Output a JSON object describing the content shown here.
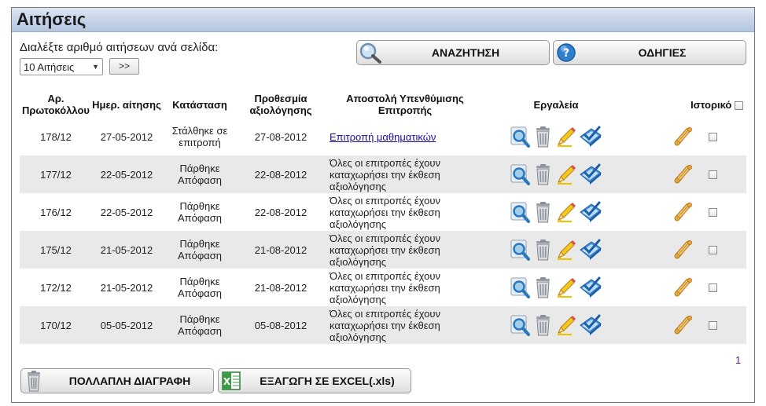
{
  "title": "Αιτήσεις",
  "perpage": {
    "label": "Διαλέξτε αριθμό αιτήσεων ανά σελίδα:",
    "selected": "10 Αιτήσεις",
    "go_label": ">>"
  },
  "buttons": {
    "search": "ΑΝΑΖΗΤΗΣΗ",
    "help": "ΟΔΗΓΙΕΣ",
    "multi_delete": "ΠΟΛΛΑΠΛΗ ΔΙΑΓΡΑΦΗ",
    "export_excel": "ΕΞΑΓΩΓΗ ΣΕ EXCEL(.xls)"
  },
  "table": {
    "headers": {
      "protocol": "Αρ. Πρωτοκόλλου",
      "date": "Ημερ. αίτησης",
      "status": "Κατάσταση",
      "deadline": "Προθεσμία αξιολόγησης",
      "reminder": "Αποστολή Υπενθύμισης Επιτροπής",
      "tools": "Εργαλεία",
      "history": "Ιστορικό"
    },
    "rows": [
      {
        "protocol": "178/12",
        "date": "27-05-2012",
        "status": "Στάλθηκε σε επιτροπή",
        "deadline": "27-08-2012",
        "reminder": "Επιτροπή μαθηματικών",
        "reminder_is_link": true
      },
      {
        "protocol": "177/12",
        "date": "22-05-2012",
        "status": "Πάρθηκε Απόφαση",
        "deadline": "22-08-2012",
        "reminder": "Όλες οι επιτροπές έχουν καταχωρήσει την έκθεση αξιολόγησης",
        "reminder_is_link": false
      },
      {
        "protocol": "176/12",
        "date": "22-05-2012",
        "status": "Πάρθηκε Απόφαση",
        "deadline": "22-08-2012",
        "reminder": "Όλες οι επιτροπές έχουν καταχωρήσει την έκθεση αξιολόγησης",
        "reminder_is_link": false
      },
      {
        "protocol": "175/12",
        "date": "21-05-2012",
        "status": "Πάρθηκε Απόφαση",
        "deadline": "21-08-2012",
        "reminder": "Όλες οι επιτροπές έχουν καταχωρήσει την έκθεση αξιολόγησης",
        "reminder_is_link": false
      },
      {
        "protocol": "172/12",
        "date": "21-05-2012",
        "status": "Πάρθηκε Απόφαση",
        "deadline": "21-08-2012",
        "reminder": "Όλες οι επιτροπές έχουν καταχωρήσει την έκθεση αξιολόγησης",
        "reminder_is_link": false
      },
      {
        "protocol": "170/12",
        "date": "05-05-2012",
        "status": "Πάρθηκε Απόφαση",
        "deadline": "05-08-2012",
        "reminder": "Όλες οι επιτροπές έχουν καταχωρήσει την έκθεση αξιολόγησης",
        "reminder_is_link": false
      }
    ]
  },
  "pagination": {
    "current_page": "1"
  },
  "icons": {
    "search": "magnifier-icon",
    "help": "help-icon",
    "view": "view-magnifier-icon",
    "delete": "trash-icon",
    "edit": "pencil-icon",
    "evaluate": "checklist-icon",
    "history": "scroll-icon",
    "excel": "excel-icon"
  },
  "colors": {
    "title_bar": "#c5d3e8",
    "odd_row": "#e9e9e9",
    "link": "#1a0dab",
    "page_link": "#551a8b"
  }
}
